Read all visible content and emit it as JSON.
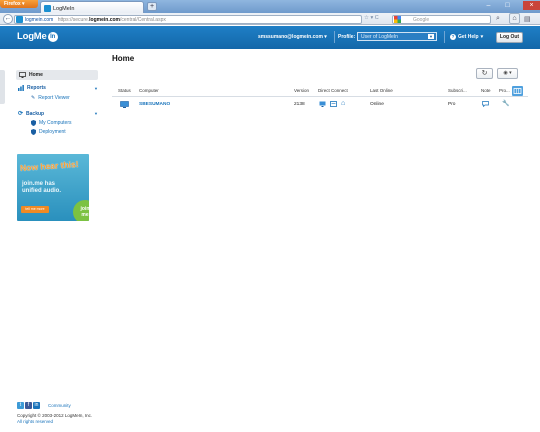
{
  "browser": {
    "app_button": "Firefox",
    "tab_title": "LogMeIn",
    "url_domain": "logmein.com",
    "url_scheme": "https://secure.",
    "url_host": "logmein.com",
    "url_path": "/central/Central.aspx",
    "search_engine": "Google",
    "search_placeholder": "Google"
  },
  "header": {
    "logo_text": "LogMe",
    "logo_in": "In",
    "user_email": "smssumano@logmein.com",
    "profile_label": "Profile:",
    "profile_value": "User of LogMeIn",
    "help_label": "Get Help",
    "logout_label": "Log Out"
  },
  "sidebar": {
    "home": "Home",
    "reports": "Reports",
    "report_viewer": "Report Viewer",
    "backup": "Backup",
    "my_computers": "My Computers",
    "deployment": "Deployment",
    "banner_headline": "Now hear this!",
    "banner_line1": "join.me has",
    "banner_line2": "unified audio.",
    "banner_cta": "tell me more",
    "banner_logo1": "join",
    "banner_logo2": "me",
    "community": "Community",
    "copyright_line1": "Copyright © 2003-2012 LogMeIn, Inc.",
    "copyright_line2": "All rights reserved"
  },
  "main": {
    "title": "Home",
    "columns": {
      "status": "Status",
      "computer": "Computer",
      "version": "Version",
      "direct_connect": "Direct Connect",
      "last_online": "Last Online",
      "subscription": "Subscri...",
      "note": "Note",
      "pro": "Pro..."
    },
    "rows": [
      {
        "computer": "SBESUMANO",
        "version": "2138",
        "last_online": "Online",
        "subscription": "Pro"
      }
    ]
  },
  "colors": {
    "brand_blue": "#1a74bb",
    "header_blue": "#1367a9",
    "firefox_orange": "#e0731a"
  }
}
